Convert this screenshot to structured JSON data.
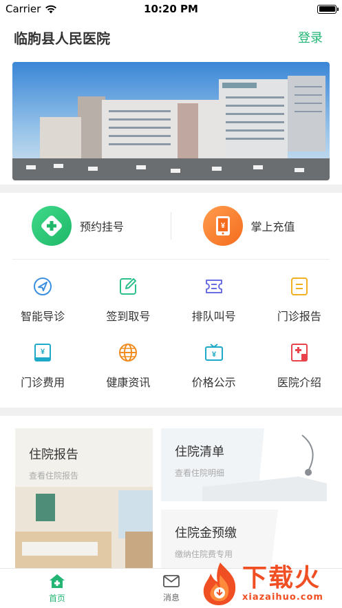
{
  "status_bar": {
    "carrier": "Carrier",
    "time": "10:20 PM"
  },
  "header": {
    "title": "临朐县人民医院",
    "login": "登录"
  },
  "quick_actions": [
    {
      "label": "预约挂号",
      "icon": "plus-cross-icon"
    },
    {
      "label": "掌上充值",
      "icon": "phone-yen-icon"
    }
  ],
  "services": [
    {
      "label": "智能导诊",
      "icon": "navigation-icon"
    },
    {
      "label": "签到取号",
      "icon": "edit-icon"
    },
    {
      "label": "排队叫号",
      "icon": "ticket-icon"
    },
    {
      "label": "门诊报告",
      "icon": "report-icon"
    },
    {
      "label": "门诊费用",
      "icon": "bill-icon"
    },
    {
      "label": "健康资讯",
      "icon": "globe-icon"
    },
    {
      "label": "价格公示",
      "icon": "price-board-icon"
    },
    {
      "label": "医院介绍",
      "icon": "hospital-icon"
    }
  ],
  "cards": {
    "report": {
      "title": "住院报告",
      "subtitle": "查看住院报告"
    },
    "list": {
      "title": "住院清单",
      "subtitle": "查看住院明细"
    },
    "prepay": {
      "title": "住院金预缴",
      "subtitle": "缴纳住院费专用"
    }
  },
  "tab_bar": [
    {
      "label": "首页",
      "icon": "home-icon"
    },
    {
      "label": "消息",
      "icon": "mail-icon"
    }
  ],
  "watermark": {
    "title": "下载火",
    "url": "xiazaihuo.com"
  },
  "colors": {
    "accent": "#22b573",
    "orange": "#f56c1e",
    "watermark": "#f04e23"
  }
}
